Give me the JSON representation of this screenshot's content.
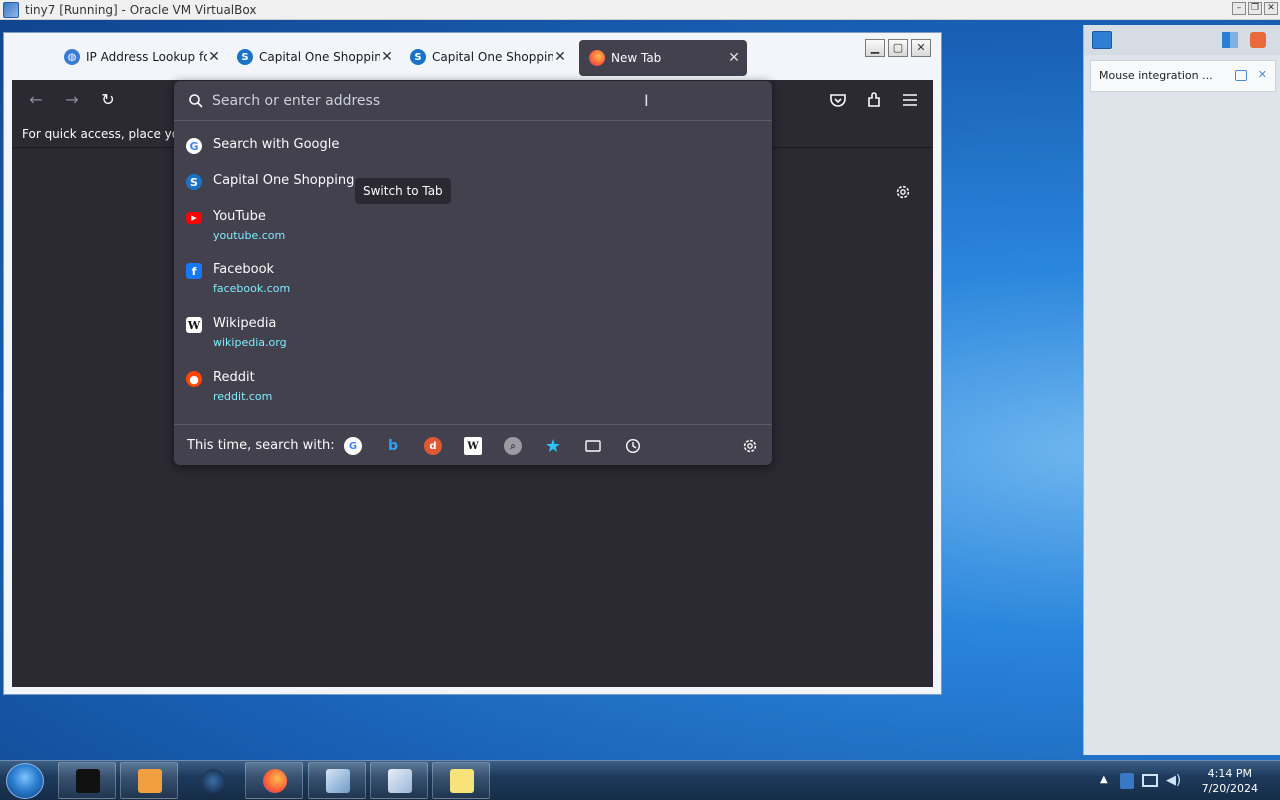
{
  "host": {
    "title": "tiny7 [Running] - Oracle VM VirtualBox"
  },
  "browser": {
    "tabs": [
      {
        "label": "IP Address Lookup fo",
        "fav_color": "#3a7bd5"
      },
      {
        "label": "Capital One Shopping",
        "fav_color": "#1a73c8"
      },
      {
        "label": "Capital One Shopping",
        "fav_color": "#1a73c8"
      },
      {
        "label": "New Tab",
        "fav_color": "#ff7139"
      }
    ],
    "bookmarks_hint": "For quick access, place your b",
    "urlbar": {
      "placeholder": "Search or enter address",
      "results": [
        {
          "title": "Search with Google",
          "url": "",
          "icon": "google-icon"
        },
        {
          "title": "Capital One Shopping",
          "url": "",
          "icon": "capital-one-icon",
          "action": "Switch to Tab"
        },
        {
          "title": "YouTube",
          "url": "youtube.com",
          "icon": "youtube-icon"
        },
        {
          "title": "Facebook",
          "url": "facebook.com",
          "icon": "facebook-icon"
        },
        {
          "title": "Wikipedia",
          "url": "wikipedia.org",
          "icon": "wikipedia-icon"
        },
        {
          "title": "Reddit",
          "url": "reddit.com",
          "icon": "reddit-icon"
        }
      ],
      "oneoff_label": "This time, search with:",
      "engines": [
        "google-icon",
        "bing-icon",
        "duckduckgo-icon",
        "wikipedia-icon",
        "search-engine-icon",
        "bookmarks-icon",
        "tabs-icon",
        "history-icon"
      ]
    }
  },
  "side_panel": {
    "notice": "Mouse integration ..."
  },
  "taskbar": {
    "time": "4:14 PM",
    "date": "7/20/2024"
  },
  "colors": {
    "ff_dark": "#2b2a33",
    "ff_panel": "#42414d",
    "url_cyan": "#80ebff"
  }
}
